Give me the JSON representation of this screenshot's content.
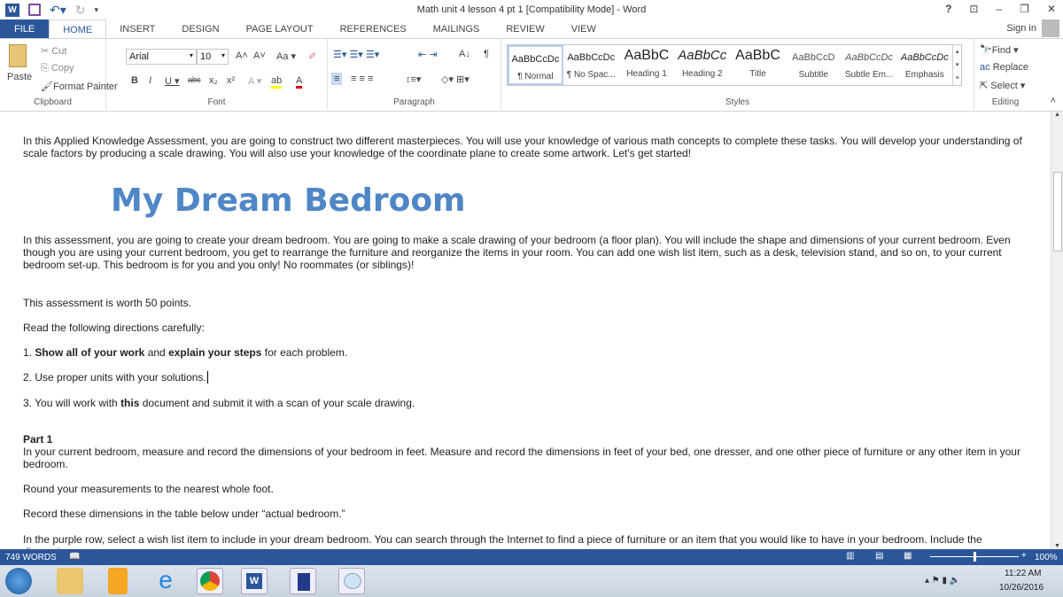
{
  "window": {
    "title": "Math unit 4 lesson 4 pt 1 [Compatibility Mode] - Word",
    "help": "?",
    "sign_in": "Sign in"
  },
  "tabs": [
    "FILE",
    "HOME",
    "INSERT",
    "DESIGN",
    "PAGE LAYOUT",
    "REFERENCES",
    "MAILINGS",
    "REVIEW",
    "VIEW"
  ],
  "clipboard": {
    "paste": "Paste",
    "cut": "Cut",
    "copy": "Copy",
    "format_painter": "Format Painter",
    "label": "Clipboard"
  },
  "font": {
    "name": "Arial",
    "size": "10",
    "case": "Aa",
    "label": "Font"
  },
  "paragraph": {
    "label": "Paragraph"
  },
  "styles": {
    "label": "Styles",
    "items": [
      {
        "preview": "AaBbCcDc",
        "name": "¶ Normal"
      },
      {
        "preview": "AaBbCcDc",
        "name": "¶ No Spac..."
      },
      {
        "preview": "AaBbC",
        "name": "Heading 1"
      },
      {
        "preview": "AaBbCc",
        "name": "Heading 2"
      },
      {
        "preview": "AaBbC",
        "name": "Title"
      },
      {
        "preview": "AaBbCcD",
        "name": "Subtitle"
      },
      {
        "preview": "AaBbCcDc",
        "name": "Subtle Em..."
      },
      {
        "preview": "AaBbCcDc",
        "name": "Emphasis"
      }
    ]
  },
  "editing": {
    "find": "Find",
    "replace": "Replace",
    "select": "Select",
    "label": "Editing"
  },
  "document": {
    "intro": "In this Applied Knowledge Assessment, you are going to construct two different masterpieces. You will use your knowledge of various math concepts to complete these tasks. You will develop your understanding of scale factors by producing a scale drawing. You will also use your knowledge of the coordinate plane to create some artwork. Let's get started!",
    "heading": "My Dream Bedroom",
    "p1": "In this assessment, you are going to create your dream bedroom. You are going to make a scale drawing of your bedroom (a floor plan). You will include the shape and dimensions of your current bedroom. Even though you are using your current bedroom, you get to rearrange the furniture and reorganize the items in your room. You can add one wish list item, such as a desk, television stand, and so on, to your current bedroom set-up. This bedroom is for you and you only! No roommates (or siblings)!",
    "p2": "This assessment is worth 50 points.",
    "p3": "Read the following directions carefully:",
    "d1a": "1. ",
    "d1b": "Show all of your work",
    "d1c": " and ",
    "d1d": "explain your steps",
    "d1e": " for each problem.",
    "d2": "2. Use proper units with your solutions.",
    "d3a": "3. You will work with ",
    "d3b": "this",
    "d3c": " document and submit it with a scan of your scale drawing.",
    "part1": "Part 1",
    "p4": "In your current bedroom, measure and record the dimensions of your bedroom in feet. Measure and record the dimensions in feet of your bed, one dresser, and one other piece of furniture or any other item in your bedroom.",
    "p5": "Round your measurements to the nearest whole foot.",
    "p6": "Record these dimensions in the table below under “actual bedroom.”",
    "p7": "In the purple row, select a wish list item to include in your dream bedroom. You can search through the Internet to find a piece of furniture or an item that you would like to have in your bedroom. Include the dimensions"
  },
  "status": {
    "words": "749 WORDS",
    "zoom": "100%",
    "zoom_level": 100
  },
  "taskbar": {
    "time": "11:22 AM",
    "date": "10/26/2016"
  },
  "colors": {
    "accent": "#2b579a",
    "heading": "#4f86c6"
  }
}
